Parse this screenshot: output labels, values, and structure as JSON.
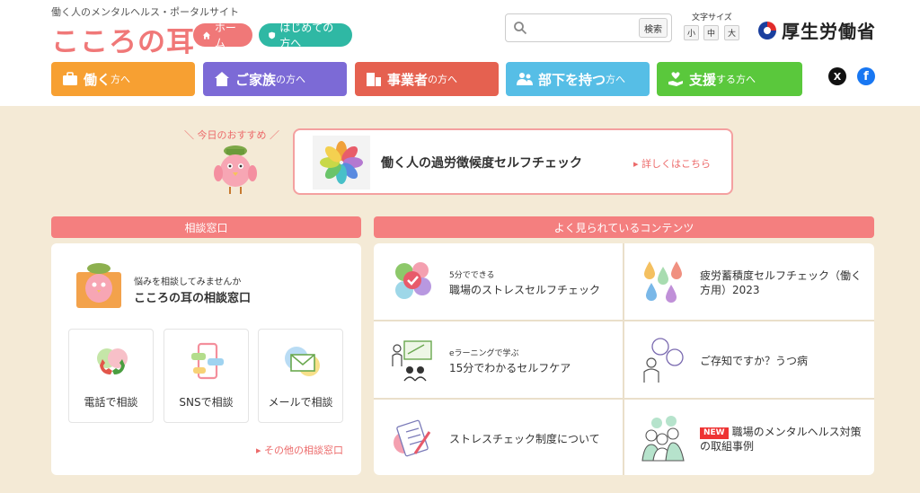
{
  "header": {
    "tagline": "働く人のメンタルヘルス・ポータルサイト",
    "logo": "こころの耳",
    "home_label": "ホーム",
    "first_label": "はじめての方へ",
    "search": {
      "placeholder": "",
      "button": "検索"
    },
    "font_size": {
      "label": "文字サイズ",
      "small": "小",
      "medium": "中",
      "large": "大"
    },
    "ministry": "厚生労働省"
  },
  "nav": [
    {
      "main": "働く",
      "suffix": "方へ",
      "icon": "briefcase-icon",
      "color": "#f7a032"
    },
    {
      "main": "ご家族",
      "suffix": "の方へ",
      "icon": "house-icon",
      "color": "#7c6ad6"
    },
    {
      "main": "事業者",
      "suffix": "の方へ",
      "icon": "building-icon",
      "color": "#e56150"
    },
    {
      "main": "部下を持つ",
      "suffix": "方へ",
      "icon": "people-icon",
      "color": "#56bee6"
    },
    {
      "main": "支援",
      "suffix": "する方へ",
      "icon": "hand-heart-icon",
      "color": "#5ac83c"
    }
  ],
  "social": {
    "x": "X",
    "facebook": "f"
  },
  "recommend": {
    "label": "＼ 今日のおすすめ ／",
    "title": "働く人の過労徴候度セルフチェック",
    "link": "詳しくはこちら"
  },
  "consult": {
    "heading": "相談窓口",
    "subtitle": "悩みを相談してみませんか",
    "title": "こころの耳の相談窓口",
    "methods": [
      {
        "label": "電話で相談",
        "icon": "phone-icon"
      },
      {
        "label": "SNSで相談",
        "icon": "smartphone-chat-icon"
      },
      {
        "label": "メールで相談",
        "icon": "mail-icon"
      }
    ],
    "more": "その他の相談窓口"
  },
  "popular": {
    "heading": "よく見られているコンテンツ",
    "items": [
      {
        "sub": "5分でできる",
        "title": "職場のストレスセルフチェック",
        "icon": "checkmark-circles-icon"
      },
      {
        "sub": "",
        "title": "疲労蓄積度セルフチェック（働く方用）2023",
        "icon": "droplets-icon"
      },
      {
        "sub": "eラーニングで学ぶ",
        "title": "15分でわかるセルフケア",
        "icon": "lecture-icon"
      },
      {
        "sub": "",
        "title": "ご存知ですか？うつ病",
        "icon": "depression-icon"
      },
      {
        "sub": "",
        "title": "ストレスチェック制度について",
        "icon": "checklist-pen-icon"
      },
      {
        "badge": "NEW",
        "title": "職場のメンタルヘルス対策の取組事例",
        "icon": "workers-icon"
      }
    ]
  },
  "colors": {
    "brand": "#f07878",
    "teal": "#2fb8a4",
    "background": "#f4ead6",
    "section_head": "#f47f7f"
  }
}
